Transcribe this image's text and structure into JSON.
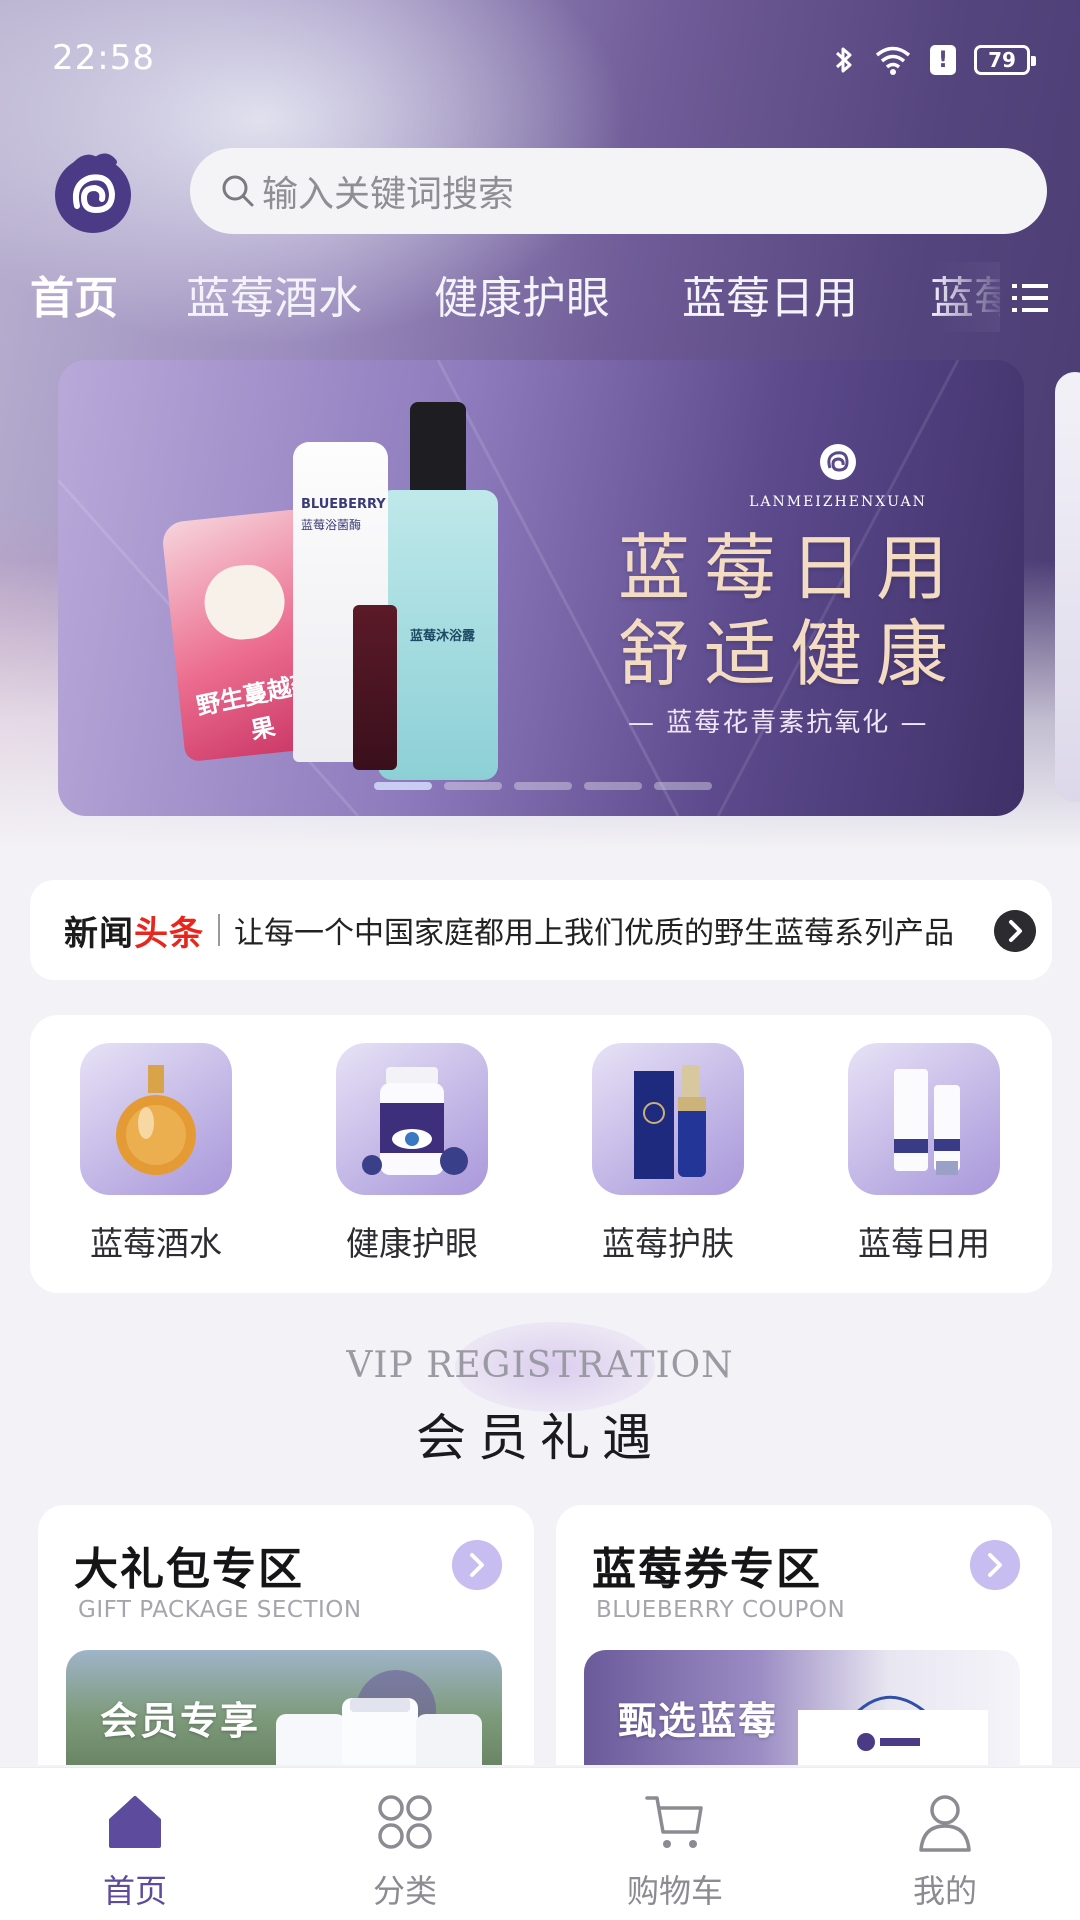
{
  "status_bar": {
    "time": "22:58",
    "battery": "79"
  },
  "search": {
    "placeholder": "输入关键词搜索"
  },
  "tabs": [
    {
      "label": "首页",
      "active": true
    },
    {
      "label": "蓝莓酒水"
    },
    {
      "label": "健康护眼"
    },
    {
      "label": "蓝莓日用"
    },
    {
      "label": "蓝莓"
    }
  ],
  "banner": {
    "brand": "LANMEIZHENXUAN",
    "title_line1": "蓝莓日用",
    "title_line2": "舒适健康",
    "subtitle": "— 蓝莓花青素抗氧化 —",
    "bag_text": "野生蔓越莓果",
    "tube_text1": "BLUEBERRY",
    "tube_text2": "蓝莓浴菌酶",
    "bottle_text": "蓝莓沐浴露",
    "slide_count": 5,
    "active_slide": 0
  },
  "news": {
    "badge_part1": "新闻",
    "badge_part2": "头条",
    "text": "让每一个中国家庭都用上我们优质的野生蓝莓系列产品"
  },
  "categories": [
    {
      "label": "蓝莓酒水",
      "icon": "liquor-bottle-icon"
    },
    {
      "label": "健康护眼",
      "icon": "eye-care-bottle-icon"
    },
    {
      "label": "蓝莓护肤",
      "icon": "skincare-set-icon"
    },
    {
      "label": "蓝莓日用",
      "icon": "daily-products-icon"
    }
  ],
  "vip": {
    "en": "VIP REGISTRATION",
    "cn": "会员礼遇"
  },
  "promos": [
    {
      "title": "大礼包专区",
      "subtitle": "GIFT PACKAGE SECTION",
      "tag": "会员专享"
    },
    {
      "title": "蓝莓券专区",
      "subtitle": "BLUEBERRY COUPON",
      "tag": "甄选蓝莓"
    }
  ],
  "tabbar": [
    {
      "label": "首页",
      "icon": "home-icon",
      "active": true
    },
    {
      "label": "分类",
      "icon": "category-grid-icon"
    },
    {
      "label": "购物车",
      "icon": "cart-icon"
    },
    {
      "label": "我的",
      "icon": "user-icon"
    }
  ],
  "colors": {
    "accent": "#5d4b9d",
    "news_red": "#e8261d",
    "arrow_bg": "#c7bdf0"
  }
}
